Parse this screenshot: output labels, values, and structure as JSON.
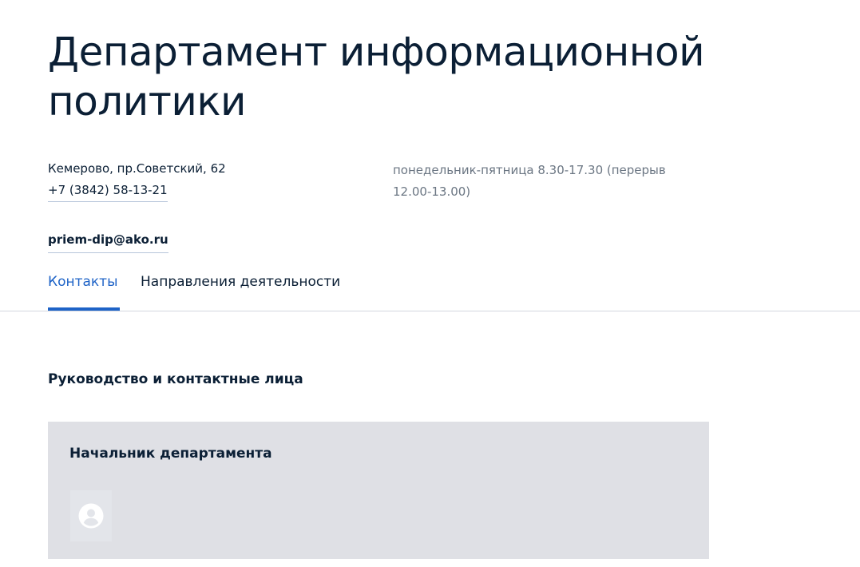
{
  "department": {
    "title": "Департамент информационной политики",
    "address": "Кемерово, пр.Советский, 62",
    "phone": "+7 (3842) 58-13-21",
    "hours": "понедельник-пятница 8.30-17.30 (перерыв 12.00-13.00)",
    "email": "priem-dip@ako.ru"
  },
  "tabs": [
    {
      "label": "Контакты",
      "active": true
    },
    {
      "label": "Направления деятельности",
      "active": false
    }
  ],
  "leadership": {
    "section_title": "Руководство и контактные лица",
    "card_title": "Начальник департамента",
    "avatar_icon": "user-placeholder-icon"
  },
  "colors": {
    "text": "#0b1f35",
    "accent": "#1e63c7",
    "muted_text": "#6b7683",
    "card_background": "#dfe0e5"
  }
}
